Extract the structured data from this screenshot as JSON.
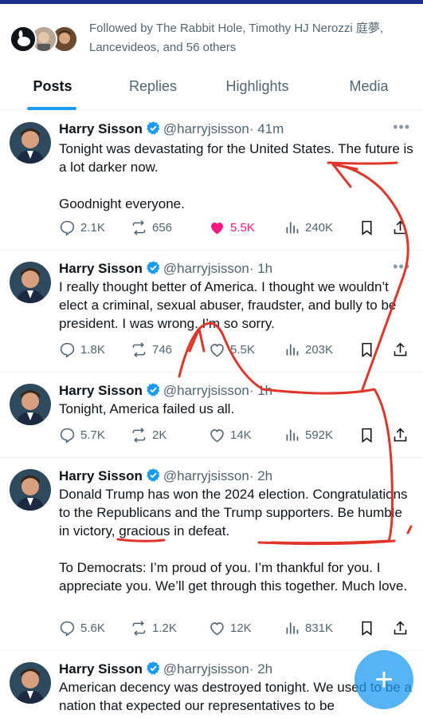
{
  "followed": {
    "text": "Followed by The Rabbit Hole, Timothy HJ Nerozzi 庭夢, Lancevideos, and 56 others"
  },
  "tabs": [
    {
      "label": "Posts"
    },
    {
      "label": "Replies"
    },
    {
      "label": "Highlights"
    },
    {
      "label": "Media"
    }
  ],
  "tweets": [
    {
      "name": "Harry Sisson",
      "handle": "@harryjsisson",
      "time": "· 41m",
      "paragraphs": [
        "Tonight was devastating for the United States. The future is a lot darker now.",
        "Goodnight everyone."
      ],
      "replies": "2.1K",
      "reposts": "656",
      "likes": "5.5K",
      "views": "240K",
      "liked": true
    },
    {
      "name": "Harry Sisson",
      "handle": "@harryjsisson",
      "time": "· 1h",
      "paragraphs": [
        "I really thought better of America. I thought we wouldn’t elect a criminal, sexual abuser, fraudster, and bully to be president. I was wrong. I’m so sorry."
      ],
      "replies": "1.8K",
      "reposts": "746",
      "likes": "5.5K",
      "views": "203K",
      "liked": false
    },
    {
      "name": "Harry Sisson",
      "handle": "@harryjsisson",
      "time": "· 1h",
      "paragraphs": [
        "Tonight, America failed us all."
      ],
      "replies": "5.7K",
      "reposts": "2K",
      "likes": "14K",
      "views": "592K",
      "liked": false
    },
    {
      "name": "Harry Sisson",
      "handle": "@harryjsisson",
      "time": "· 2h",
      "paragraphs": [
        "Donald Trump has won the 2024 election. Congratulations to the Republicans and the Trump supporters. Be humble in victory, gracious in defeat.",
        "To Democrats: I’m proud of you. I’m thankful for you. I appreciate you. We’ll get through this together. Much love."
      ],
      "replies": "5.6K",
      "reposts": "1.2K",
      "likes": "12K",
      "views": "831K",
      "liked": false
    },
    {
      "name": "Harry Sisson",
      "handle": "@harryjsisson",
      "time": "· 2h",
      "paragraphs": [
        "American decency was destroyed tonight. We used to be a nation that expected our representatives to be"
      ]
    }
  ],
  "fab": {
    "label": "+"
  },
  "colors": {
    "accent": "#1d9bf0",
    "like": "#f91880",
    "annotation": "#e0352b",
    "verified": "#1d9bf0"
  }
}
